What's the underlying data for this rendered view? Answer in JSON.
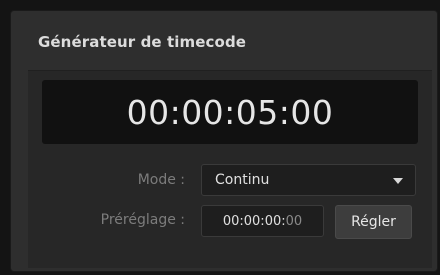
{
  "panel": {
    "title": "Générateur de timecode"
  },
  "display": {
    "timecode": "00:00:05:00"
  },
  "mode": {
    "label": "Mode :",
    "selected": "Continu"
  },
  "preset": {
    "label": "Préréglage :",
    "value_main": "00:00:00:",
    "value_dim": "00",
    "apply_label": "Régler"
  },
  "colors": {
    "panel_bg": "#2e2e2e",
    "display_bg": "#111111",
    "label_text": "#7c7c7c",
    "primary_text": "#e0e0e0"
  },
  "icons": {
    "dropdown": "chevron-down-icon"
  }
}
